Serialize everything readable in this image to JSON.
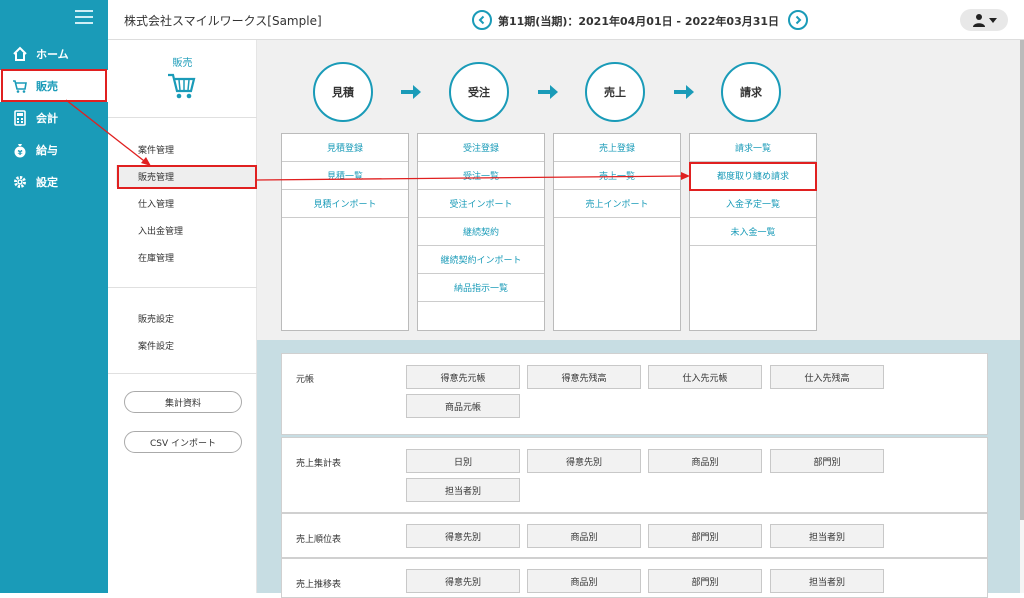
{
  "nav": {
    "items": [
      {
        "label": "ホーム",
        "icon": "home-icon"
      },
      {
        "label": "販売",
        "icon": "cart-icon"
      },
      {
        "label": "会計",
        "icon": "calculator-icon"
      },
      {
        "label": "給与",
        "icon": "money-bag-icon"
      },
      {
        "label": "設定",
        "icon": "gear-icon"
      }
    ]
  },
  "header": {
    "company": "株式会社スマイルワークス[Sample]",
    "period": "第11期(当期)：2021年04月01日 - 2022年03月31日"
  },
  "submenu": {
    "title": "販売",
    "links": [
      "案件管理",
      "販売管理",
      "仕入管理",
      "入出金管理",
      "在庫管理"
    ],
    "settings": [
      "販売設定",
      "案件設定"
    ],
    "buttons": [
      "集計資料",
      "CSV インポート"
    ]
  },
  "flow": {
    "stages": [
      "見積",
      "受注",
      "売上",
      "請求"
    ],
    "columns": [
      [
        "見積登録",
        "見積一覧",
        "見積インポート"
      ],
      [
        "受注登録",
        "受注一覧",
        "受注インポート",
        "継続契約",
        "継続契約インポート",
        "納品指示一覧"
      ],
      [
        "売上登録",
        "売上一覧",
        "売上インポート"
      ],
      [
        "請求一覧",
        "都度取り纏め請求",
        "入金予定一覧",
        "未入金一覧"
      ]
    ]
  },
  "reports": [
    {
      "label": "元帳",
      "buttons": [
        "得意先元帳",
        "得意先残高",
        "仕入先元帳",
        "仕入先残高",
        "商品元帳"
      ]
    },
    {
      "label": "売上集計表",
      "buttons": [
        "日別",
        "得意先別",
        "商品別",
        "部門別",
        "担当者別"
      ]
    },
    {
      "label": "売上順位表",
      "buttons": [
        "得意先別",
        "商品別",
        "部門別",
        "担当者別"
      ]
    },
    {
      "label": "売上推移表",
      "buttons": [
        "得意先別",
        "商品別",
        "部門別",
        "担当者別"
      ]
    }
  ],
  "colors": {
    "accent": "#1a9bb8",
    "highlight": "#e02020"
  }
}
